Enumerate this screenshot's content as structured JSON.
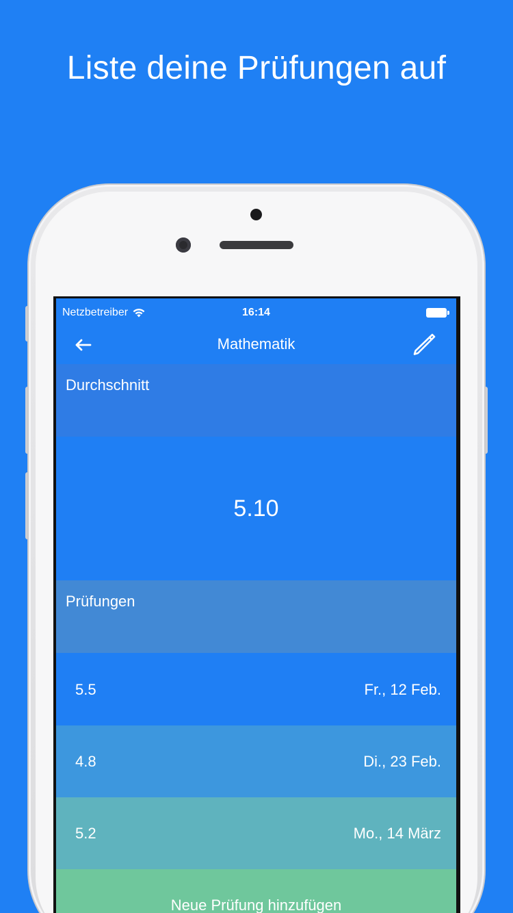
{
  "headline": "Liste deine Prüfungen auf",
  "status_bar": {
    "carrier": "Netzbetreiber",
    "time": "16:14"
  },
  "nav": {
    "title": "Mathematik",
    "back_icon": "arrow-left-icon",
    "edit_icon": "pencil-icon"
  },
  "average": {
    "header": "Durchschnitt",
    "value": "5.10"
  },
  "exams": {
    "header": "Prüfungen",
    "items": [
      {
        "grade": "5.5",
        "date": "Fr., 12 Feb."
      },
      {
        "grade": "4.8",
        "date": "Di., 23 Feb."
      },
      {
        "grade": "5.2",
        "date": "Mo., 14 März"
      }
    ],
    "add_label": "Neue Prüfung hinzufügen"
  },
  "colors": {
    "background": "#1f80f4",
    "header_avg": "#2f7ce5",
    "header_exams": "#4289d5",
    "row_1": "#1f7ff4",
    "row_2": "#3d97de",
    "row_3": "#5fb3be",
    "add_row": "#6fc79c"
  }
}
